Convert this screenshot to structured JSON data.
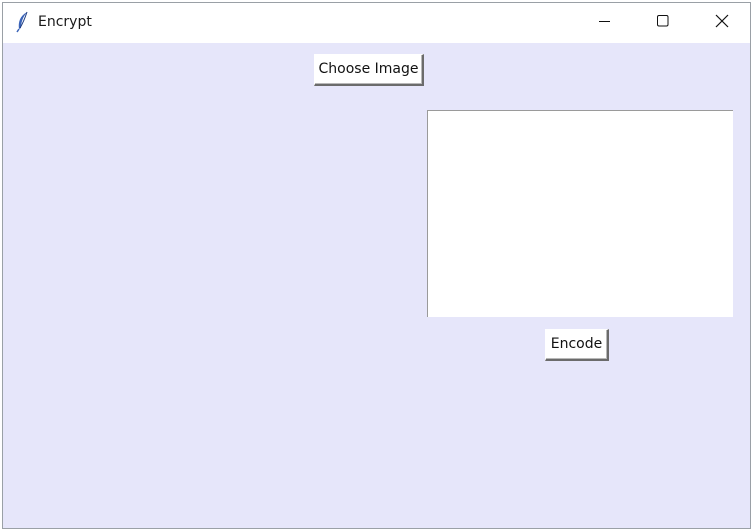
{
  "window": {
    "title": "Encrypt",
    "icon": "feather-icon",
    "background_color": "#e6e6fa",
    "controls": {
      "minimize": "minimize-icon",
      "maximize": "maximize-icon",
      "close": "close-icon"
    }
  },
  "main": {
    "choose_image_label": "Choose Image",
    "message_text": "",
    "encode_label": "Encode"
  }
}
